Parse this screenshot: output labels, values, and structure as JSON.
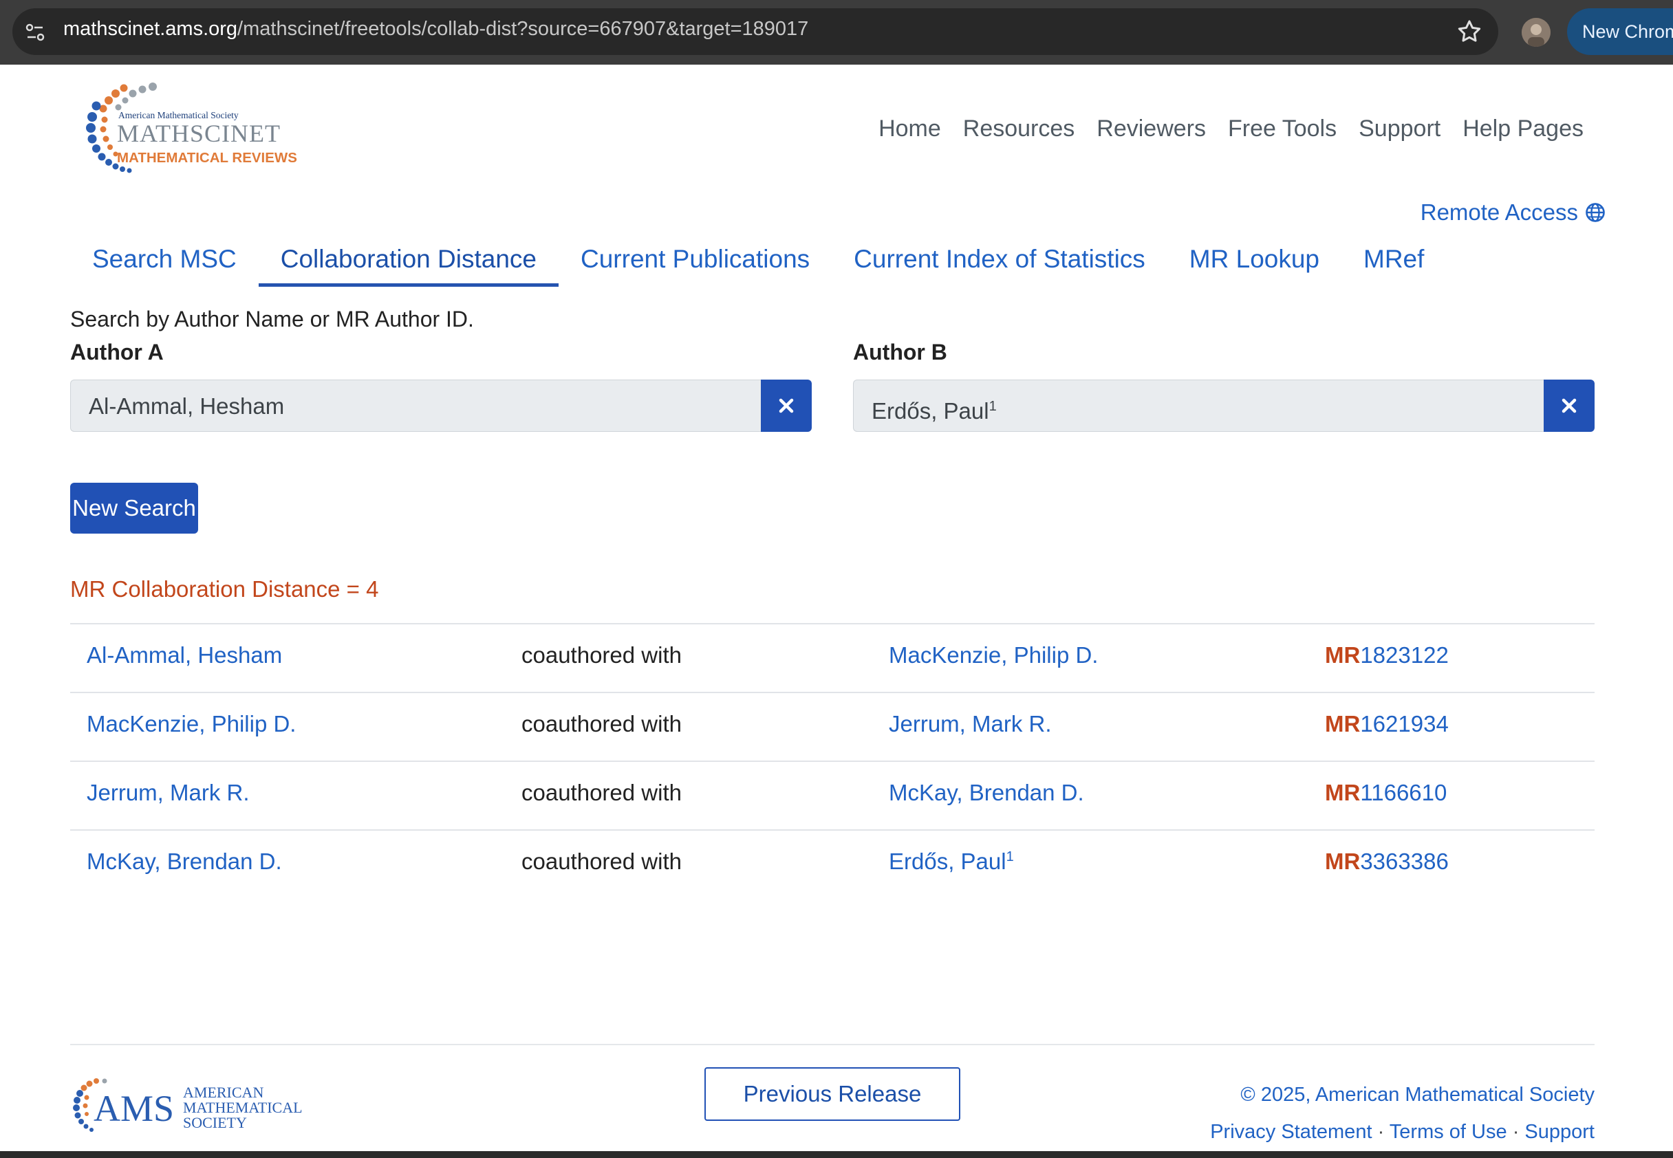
{
  "browser": {
    "url_host": "mathscinet.ams.org",
    "url_path": "/mathscinet/freetools/collab-dist?source=667907&target=189017",
    "new_chrome_label": "New Chrome"
  },
  "brand": {
    "top_line": "American Mathematical Society",
    "name": "MATHSCINET",
    "tagline": "MATHEMATICAL REVIEWS"
  },
  "topnav": [
    "Home",
    "Resources",
    "Reviewers",
    "Free Tools",
    "Support",
    "Help Pages"
  ],
  "remote_access": "Remote Access",
  "tabs": [
    "Search MSC",
    "Collaboration Distance",
    "Current Publications",
    "Current Index of Statistics",
    "MR Lookup",
    "MRef"
  ],
  "active_tab": "Collaboration Distance",
  "form": {
    "hint": "Search by Author Name or MR Author ID.",
    "author_a_label": "Author A",
    "author_a_value": "Al-Ammal, Hesham",
    "author_b_label": "Author B",
    "author_b_value": "Erdős, Paul",
    "author_b_sup": "1",
    "new_search": "New Search"
  },
  "results": {
    "distance": "MR Collaboration Distance = 4",
    "mr_prefix": "MR",
    "rows": [
      {
        "a": "Al-Ammal, Hesham",
        "rel": "coauthored with",
        "b": "MacKenzie, Philip D.",
        "b_sup": "",
        "mr": "1823122"
      },
      {
        "a": "MacKenzie, Philip D.",
        "rel": "coauthored with",
        "b": "Jerrum, Mark R.",
        "b_sup": "",
        "mr": "1621934"
      },
      {
        "a": "Jerrum, Mark R.",
        "rel": "coauthored with",
        "b": "McKay, Brendan D.",
        "b_sup": "",
        "mr": "1166610"
      },
      {
        "a": "McKay, Brendan D.",
        "rel": "coauthored with",
        "b": "Erdős, Paul",
        "b_sup": "1",
        "mr": "3363386"
      }
    ]
  },
  "footer": {
    "ams_lines": [
      "AMERICAN",
      "MATHEMATICAL",
      "SOCIETY"
    ],
    "ams_short": "AMS",
    "previous_release": "Previous Release",
    "copyright": "© 2025, American Mathematical Society",
    "links": [
      "Privacy Statement",
      "Terms of Use",
      "Support"
    ],
    "link_separator": "·"
  },
  "colors": {
    "primary": "#2151b5",
    "link": "#2062c4",
    "accent_orange": "#c2461b"
  },
  "icons": [
    "site-info-icon",
    "star-icon",
    "globe-icon",
    "close-icon"
  ]
}
